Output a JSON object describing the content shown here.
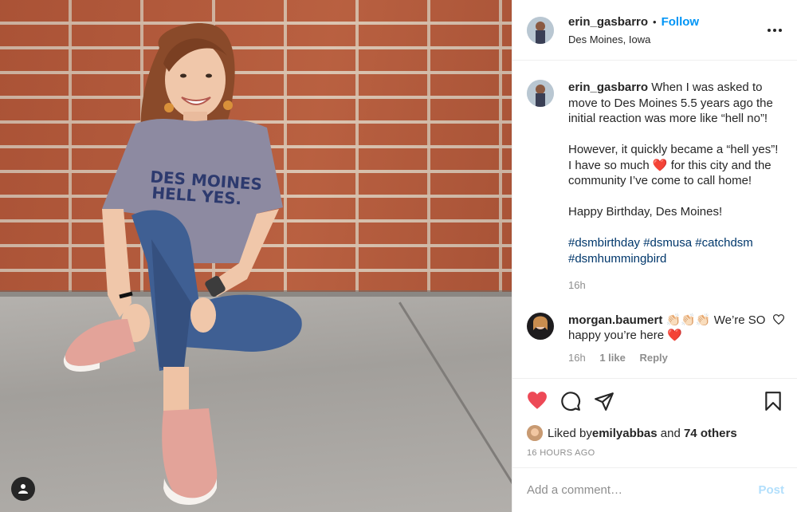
{
  "post": {
    "author": "erin_gasbarro",
    "follow_label": "Follow",
    "separator": "•",
    "location": "Des Moines, Iowa",
    "shirt_text_line1": "DES MOINES",
    "shirt_text_line2": "HELL YES."
  },
  "caption": {
    "username": "erin_gasbarro",
    "para1": " When I was asked to move to Des Moines 5.5 years ago the initial reaction was more like “hell no”!",
    "para2_before": "However, it quickly became a “hell yes”! I have so much ",
    "para2_heart": "❤️",
    "para2_after": " for this city and the community I’ve come to call home!",
    "para3": "Happy Birthday, Des Moines!",
    "hashtags": [
      "#dsmbirthday",
      "#dsmusa",
      "#catchdsm",
      "#dsmhummingbird"
    ],
    "time": "16h"
  },
  "comment": {
    "username": "morgan.baumert",
    "claps": "👏🏻👏🏻👏🏻",
    "text": " We’re SO happy you’re here ",
    "heart": "❤️",
    "time": "16h",
    "likes": "1 like",
    "reply_label": "Reply"
  },
  "likes": {
    "prefix": "Liked by ",
    "user": "emilyabbas",
    "middle": " and ",
    "others": "74 others"
  },
  "timestamp": "16 HOURS AGO",
  "add_comment": {
    "placeholder": "Add a comment…",
    "post_label": "Post"
  },
  "colors": {
    "link_blue": "#0095f6",
    "hashtag": "#00376b",
    "like_red": "#ed4956",
    "post_disabled": "#b2dffc"
  },
  "icons": {
    "more": "more-options-icon",
    "like": "heart-filled-icon",
    "comment": "comment-bubble-icon",
    "share": "paper-plane-icon",
    "save": "bookmark-icon",
    "comment_like": "heart-outline-icon",
    "user_tag": "user-tag-icon"
  }
}
